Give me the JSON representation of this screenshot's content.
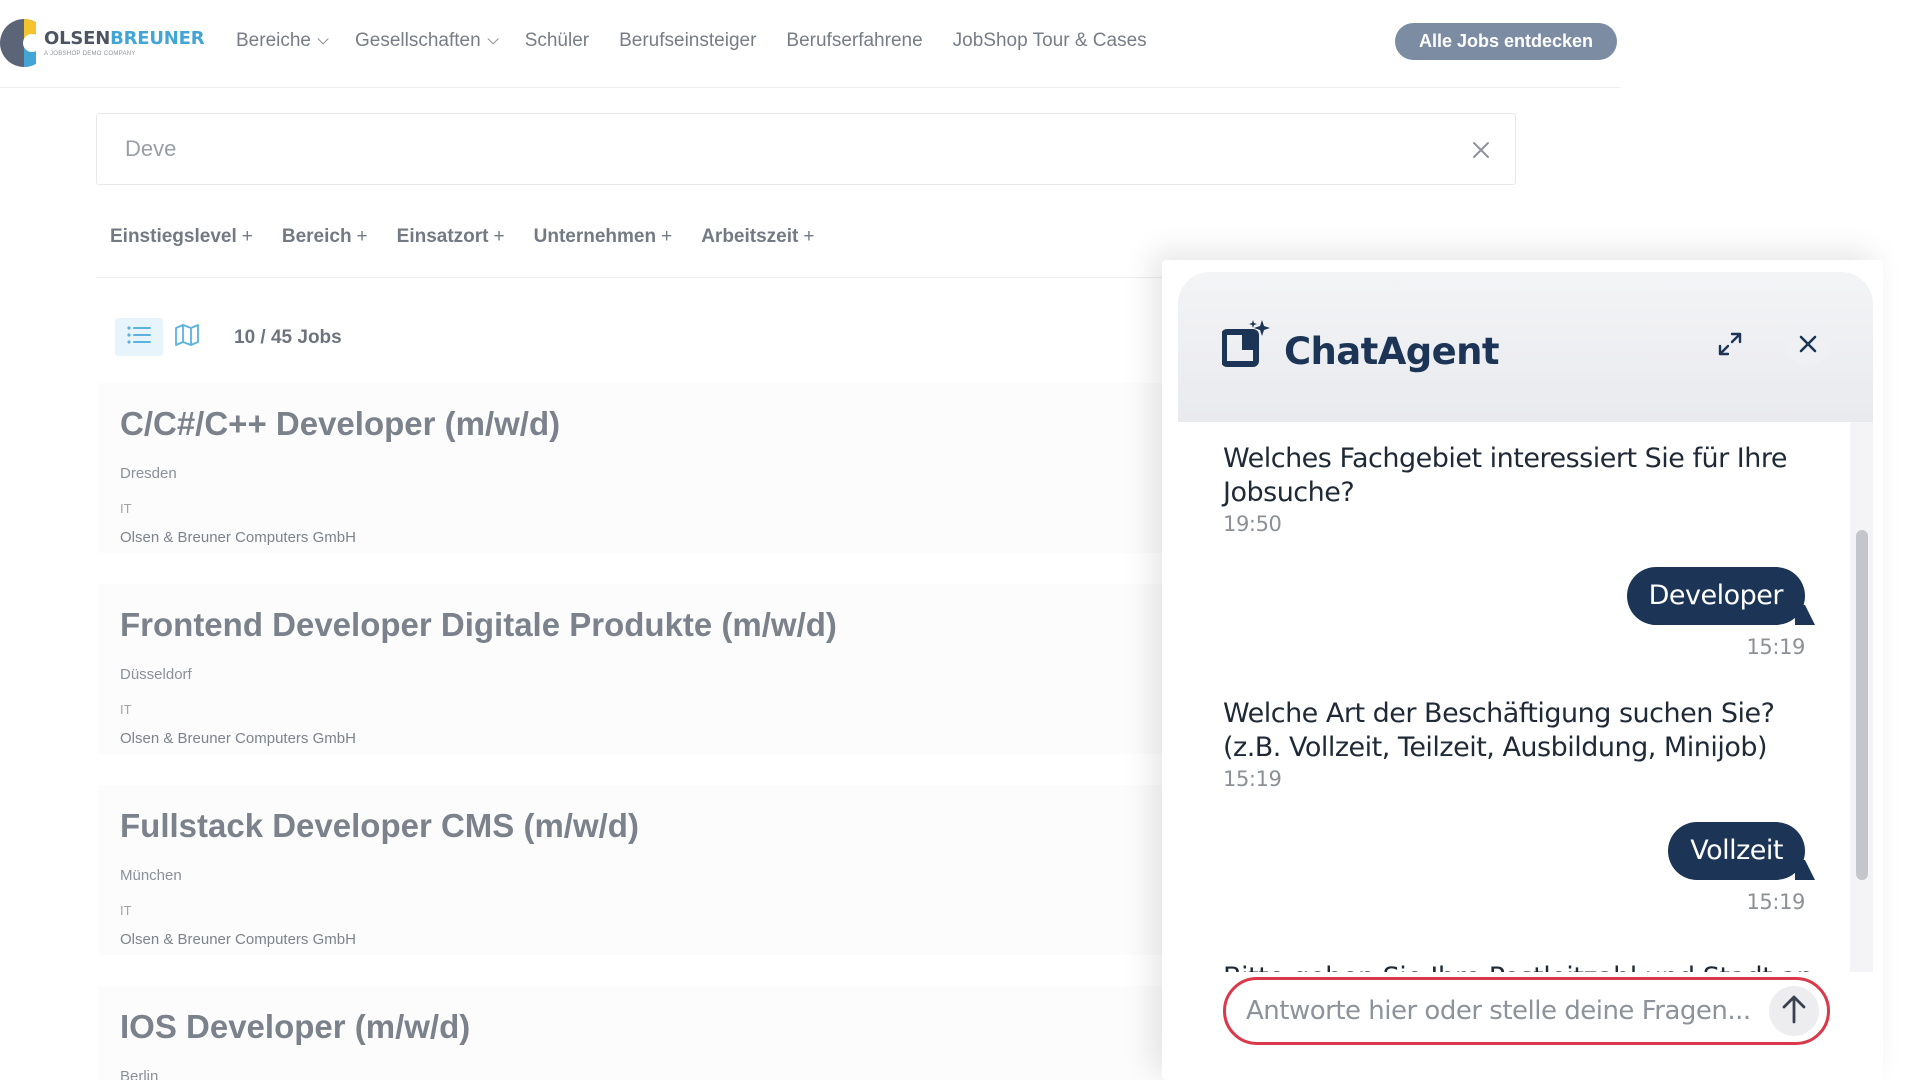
{
  "header": {
    "logo": {
      "name_part1": "OLSEN",
      "name_part2": "BREUNER",
      "tagline": "A JOBSHOP DEMO COMPANY"
    },
    "nav": [
      {
        "label": "Bereiche",
        "has_dropdown": true
      },
      {
        "label": "Gesellschaften",
        "has_dropdown": true
      },
      {
        "label": "Schüler",
        "has_dropdown": false
      },
      {
        "label": "Berufseinsteiger",
        "has_dropdown": false
      },
      {
        "label": "Berufserfahrene",
        "has_dropdown": false
      },
      {
        "label": "JobShop Tour & Cases",
        "has_dropdown": false
      }
    ],
    "cta_label": "Alle Jobs entdecken",
    "cta_color": "#7c8da3"
  },
  "search": {
    "value": "Deve",
    "clear_icon": "close-icon"
  },
  "filters": [
    "Einstiegslevel",
    "Bereich",
    "Einsatzort",
    "Unternehmen",
    "Arbeitszeit"
  ],
  "toolbar": {
    "list_view_icon": "list-icon",
    "map_view_icon": "map-icon",
    "count": "10 / 45 Jobs"
  },
  "jobs": [
    {
      "title": "C/C#/C++ Developer (m/w/d)",
      "location": "Dresden",
      "category": "IT",
      "company": "Olsen & Breuner Computers GmbH"
    },
    {
      "title": "Frontend Developer Digitale Produkte (m/w/d)",
      "location": "Düsseldorf",
      "category": "IT",
      "company": "Olsen & Breuner Computers GmbH"
    },
    {
      "title": "Fullstack Developer CMS (m/w/d)",
      "location": "München",
      "category": "IT",
      "company": "Olsen & Breuner Computers GmbH"
    },
    {
      "title": "IOS Developer (m/w/d)",
      "location": "Berlin",
      "category": "",
      "company": ""
    }
  ],
  "chat": {
    "title": "ChatAgent",
    "brand_color": "#1c3557",
    "messages": [
      {
        "role": "bot",
        "text": "Welches Fachgebiet interessiert Sie für Ihre Jobsuche?",
        "time": "19:50"
      },
      {
        "role": "user",
        "text": "Developer",
        "time": "15:19"
      },
      {
        "role": "bot",
        "text": "Welche Art der Beschäftigung suchen Sie? (z.B. Vollzeit, Teilzeit, Ausbildung, Minijob)",
        "time": "15:19"
      },
      {
        "role": "user",
        "text": "Vollzeit",
        "time": "15:19"
      }
    ],
    "partial_message": "Bitte geben Sie Ihre Postleitzahl und Stadt an",
    "input_placeholder": "Antworte hier oder stelle deine Fragen...",
    "input_value": "",
    "focus_ring_color": "#d9394a"
  }
}
